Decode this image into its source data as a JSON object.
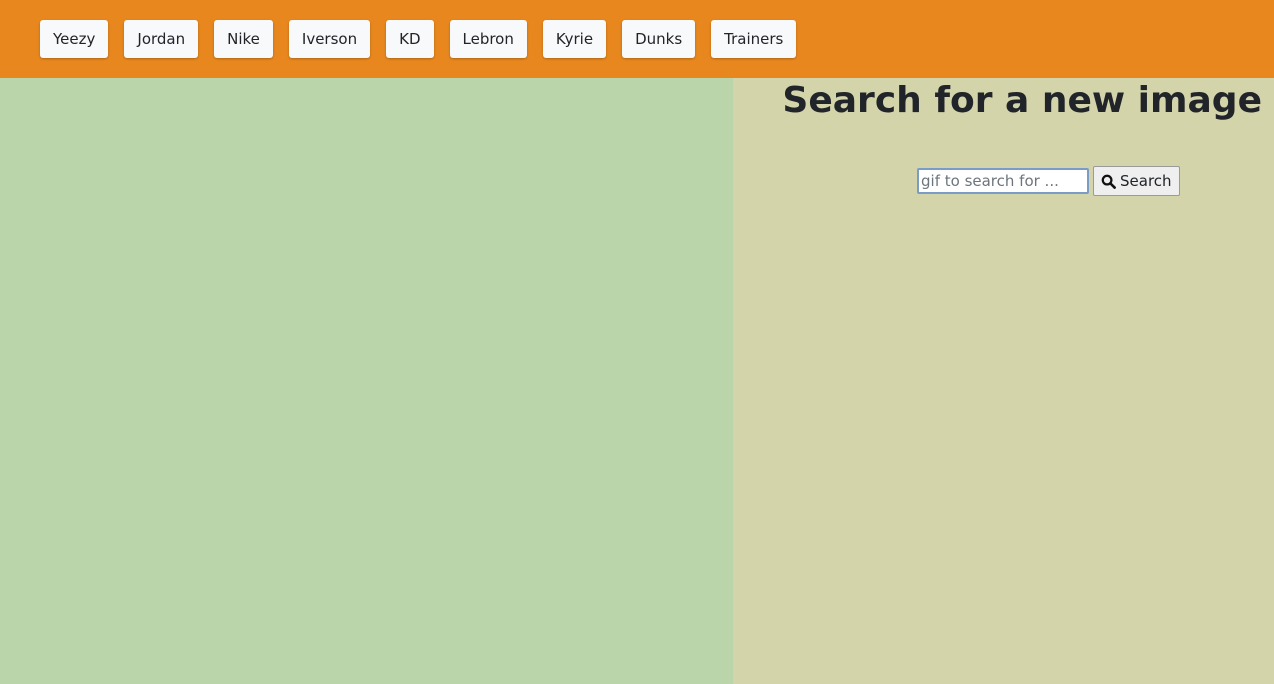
{
  "topics": [
    "Yeezy",
    "Jordan",
    "Nike",
    "Iverson",
    "KD",
    "Lebron",
    "Kyrie",
    "Dunks",
    "Trainers"
  ],
  "search_panel": {
    "title": "Search for a new image",
    "input_placeholder": "gif to search for ...",
    "input_value": "",
    "button_label": "Search",
    "button_icon": "search-icon"
  },
  "colors": {
    "header": "#e8871e",
    "left_pane": "#bad5aa",
    "right_pane": "#d3d4aa"
  }
}
